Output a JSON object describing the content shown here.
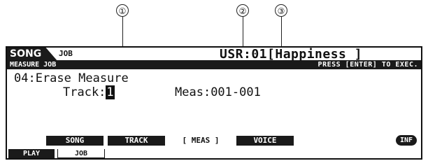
{
  "callouts": [
    "①",
    "②",
    "③"
  ],
  "header": {
    "mode": "SONG",
    "sub_mode": "JOB",
    "song_name": "USR:01[Happiness ]"
  },
  "title_bar": {
    "screen": "MEASURE JOB",
    "hint": "PRESS [ENTER] TO EXEC."
  },
  "job": {
    "name": "04:Erase Measure",
    "track_label": "Track:",
    "track_value": "1",
    "meas_label": "Meas:",
    "meas_range": "001-001"
  },
  "soft_keys": [
    {
      "label": "SONG"
    },
    {
      "label": "TRACK"
    },
    {
      "label": "[ MEAS ]"
    },
    {
      "label": "VOICE"
    }
  ],
  "info_button": "INF",
  "tabs": {
    "play": "PLAY",
    "job": "JOB"
  }
}
